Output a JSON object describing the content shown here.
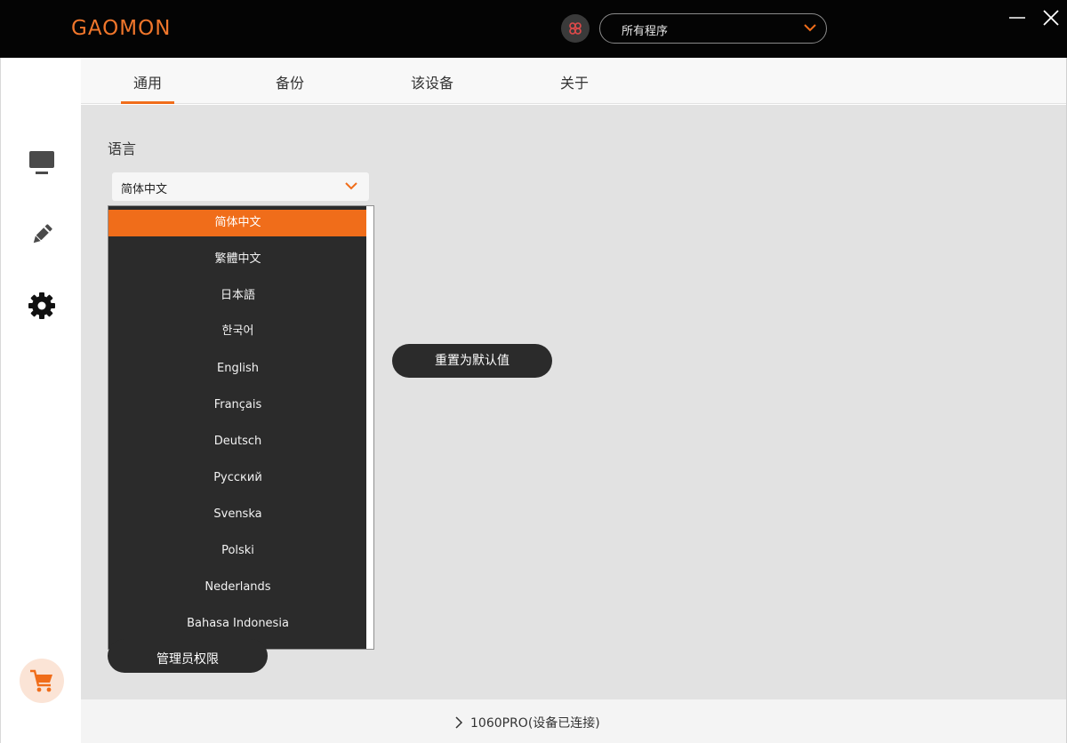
{
  "app": {
    "logo_text": "GAOMON",
    "brand_color": "#f06d1a"
  },
  "header": {
    "program_select_value": "所有程序",
    "app_icon": "app-launcher-icon"
  },
  "tabs": [
    {
      "label": "通用",
      "active": true
    },
    {
      "label": "备份",
      "active": false
    },
    {
      "label": "该设备",
      "active": false
    },
    {
      "label": "关于",
      "active": false
    }
  ],
  "sidebar": {
    "items": [
      {
        "icon": "monitor-icon"
      },
      {
        "icon": "pen-icon"
      },
      {
        "icon": "settings-icon",
        "active": true
      }
    ],
    "shop_icon": "cart-icon"
  },
  "general": {
    "language_label": "语言",
    "language_selected": "简体中文",
    "language_options": [
      "简体中文",
      "繁體中文",
      "日本語",
      "한국어",
      "English",
      "Français",
      "Deutsch",
      "Русский",
      "Svenska",
      "Polski",
      "Nederlands",
      "Bahasa Indonesia"
    ],
    "reset_button": "重置为默认值",
    "admin_button": "管理员权限"
  },
  "footer": {
    "device_status": "1060PRO(设备已连接)"
  }
}
